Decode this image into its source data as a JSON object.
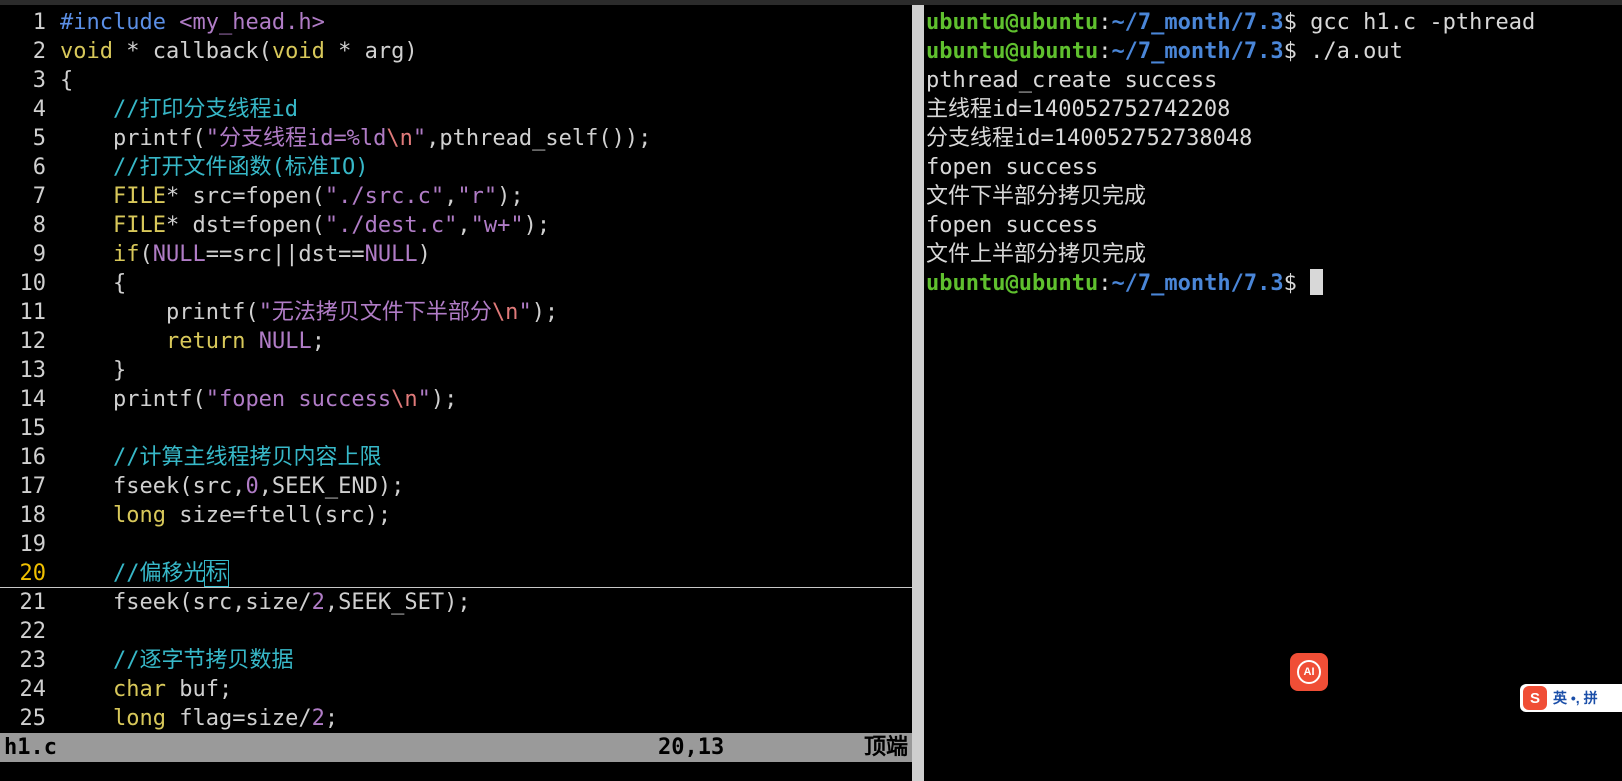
{
  "vim": {
    "lines": [
      {
        "n": "1",
        "segs": [
          {
            "t": "#include ",
            "c": "tok-pre"
          },
          {
            "t": "<my_head.h>",
            "c": "tok-inc"
          }
        ]
      },
      {
        "n": "2",
        "segs": [
          {
            "t": "void",
            "c": "tok-type"
          },
          {
            "t": " * callback(",
            "c": ""
          },
          {
            "t": "void",
            "c": "tok-type"
          },
          {
            "t": " * arg)",
            "c": ""
          }
        ]
      },
      {
        "n": "3",
        "segs": [
          {
            "t": "{",
            "c": ""
          }
        ]
      },
      {
        "n": "4",
        "segs": [
          {
            "t": "    //打印分支线程id",
            "c": "tok-comment"
          }
        ]
      },
      {
        "n": "5",
        "segs": [
          {
            "t": "    printf(",
            "c": ""
          },
          {
            "t": "\"分支线程id=%ld",
            "c": "tok-str"
          },
          {
            "t": "\\n",
            "c": "tok-esc"
          },
          {
            "t": "\"",
            "c": "tok-str"
          },
          {
            "t": ",pthread_self());",
            "c": ""
          }
        ]
      },
      {
        "n": "6",
        "segs": [
          {
            "t": "    //打开文件函数(标准IO)",
            "c": "tok-comment"
          }
        ]
      },
      {
        "n": "7",
        "segs": [
          {
            "t": "    ",
            "c": ""
          },
          {
            "t": "FILE",
            "c": "tok-type"
          },
          {
            "t": "* src=fopen(",
            "c": ""
          },
          {
            "t": "\"./src.c\"",
            "c": "tok-str"
          },
          {
            "t": ",",
            "c": ""
          },
          {
            "t": "\"r\"",
            "c": "tok-str"
          },
          {
            "t": ");",
            "c": ""
          }
        ]
      },
      {
        "n": "8",
        "segs": [
          {
            "t": "    ",
            "c": ""
          },
          {
            "t": "FILE",
            "c": "tok-type"
          },
          {
            "t": "* dst=fopen(",
            "c": ""
          },
          {
            "t": "\"./dest.c\"",
            "c": "tok-str"
          },
          {
            "t": ",",
            "c": ""
          },
          {
            "t": "\"w+\"",
            "c": "tok-str"
          },
          {
            "t": ");",
            "c": ""
          }
        ]
      },
      {
        "n": "9",
        "segs": [
          {
            "t": "    ",
            "c": ""
          },
          {
            "t": "if",
            "c": "tok-kw"
          },
          {
            "t": "(",
            "c": ""
          },
          {
            "t": "NULL",
            "c": "tok-const"
          },
          {
            "t": "==src||dst==",
            "c": ""
          },
          {
            "t": "NULL",
            "c": "tok-const"
          },
          {
            "t": ")",
            "c": ""
          }
        ]
      },
      {
        "n": "10",
        "segs": [
          {
            "t": "    {",
            "c": ""
          }
        ]
      },
      {
        "n": "11",
        "segs": [
          {
            "t": "        printf(",
            "c": ""
          },
          {
            "t": "\"无法拷贝文件下半部分",
            "c": "tok-str"
          },
          {
            "t": "\\n",
            "c": "tok-esc"
          },
          {
            "t": "\"",
            "c": "tok-str"
          },
          {
            "t": ");",
            "c": ""
          }
        ]
      },
      {
        "n": "12",
        "segs": [
          {
            "t": "        ",
            "c": ""
          },
          {
            "t": "return",
            "c": "tok-kw"
          },
          {
            "t": " ",
            "c": ""
          },
          {
            "t": "NULL",
            "c": "tok-const"
          },
          {
            "t": ";",
            "c": ""
          }
        ]
      },
      {
        "n": "13",
        "segs": [
          {
            "t": "    }",
            "c": ""
          }
        ]
      },
      {
        "n": "14",
        "segs": [
          {
            "t": "    printf(",
            "c": ""
          },
          {
            "t": "\"fopen success",
            "c": "tok-str"
          },
          {
            "t": "\\n",
            "c": "tok-esc"
          },
          {
            "t": "\"",
            "c": "tok-str"
          },
          {
            "t": ");",
            "c": ""
          }
        ]
      },
      {
        "n": "15",
        "segs": []
      },
      {
        "n": "16",
        "segs": [
          {
            "t": "    //计算主线程拷贝内容上限",
            "c": "tok-comment"
          }
        ]
      },
      {
        "n": "17",
        "segs": [
          {
            "t": "    fseek(src,",
            "c": ""
          },
          {
            "t": "0",
            "c": "tok-const"
          },
          {
            "t": ",SEEK_END);",
            "c": ""
          }
        ]
      },
      {
        "n": "18",
        "segs": [
          {
            "t": "    ",
            "c": ""
          },
          {
            "t": "long",
            "c": "tok-type"
          },
          {
            "t": " size=ftell(src);",
            "c": ""
          }
        ]
      },
      {
        "n": "19",
        "segs": []
      },
      {
        "n": "20",
        "current": true,
        "segs": [
          {
            "t": "    //偏移光",
            "c": "tok-comment"
          },
          {
            "t": "标",
            "c": "tok-comment cursor-box"
          }
        ]
      },
      {
        "n": "21",
        "segs": [
          {
            "t": "    fseek(src,size/",
            "c": ""
          },
          {
            "t": "2",
            "c": "tok-const"
          },
          {
            "t": ",SEEK_SET);",
            "c": ""
          }
        ]
      },
      {
        "n": "22",
        "segs": []
      },
      {
        "n": "23",
        "segs": [
          {
            "t": "    //逐字节拷贝数据",
            "c": "tok-comment"
          }
        ]
      },
      {
        "n": "24",
        "segs": [
          {
            "t": "    ",
            "c": ""
          },
          {
            "t": "char",
            "c": "tok-type"
          },
          {
            "t": " buf;",
            "c": ""
          }
        ]
      },
      {
        "n": "25",
        "segs": [
          {
            "t": "    ",
            "c": ""
          },
          {
            "t": "long",
            "c": "tok-type"
          },
          {
            "t": " flag=size/",
            "c": ""
          },
          {
            "t": "2",
            "c": "tok-const"
          },
          {
            "t": ";",
            "c": ""
          }
        ]
      }
    ],
    "status": {
      "file": "h1.c",
      "position": "20,13",
      "scroll": "顶端"
    }
  },
  "terminal": {
    "prompt": {
      "user": "ubuntu@ubuntu",
      "colon": ":",
      "path": "~/7_month/7.3",
      "dollar": "$ "
    },
    "lines": [
      {
        "type": "prompt",
        "cmd": "gcc h1.c -pthread"
      },
      {
        "type": "prompt",
        "cmd": "./a.out"
      },
      {
        "type": "out",
        "text": "pthread_create success"
      },
      {
        "type": "out",
        "text": "主线程id=140052752742208"
      },
      {
        "type": "out",
        "text": "分支线程id=140052752738048"
      },
      {
        "type": "out",
        "text": "fopen success"
      },
      {
        "type": "out",
        "text": "文件下半部分拷贝完成"
      },
      {
        "type": "out",
        "text": "fopen success"
      },
      {
        "type": "out",
        "text": "文件上半部分拷贝完成"
      },
      {
        "type": "prompt",
        "cmd": "",
        "cursor": true
      }
    ]
  },
  "widgets": {
    "ai_label": "AI",
    "ime_logo": "S",
    "ime_text": "英 •, 拼"
  },
  "colors": {
    "comment": "#37b8c8",
    "type": "#d8c85a",
    "string": "#b07cc6",
    "prompt_user": "#5fc02e",
    "prompt_path": "#4a86d8",
    "statusline_bg": "#9a9a9a"
  }
}
